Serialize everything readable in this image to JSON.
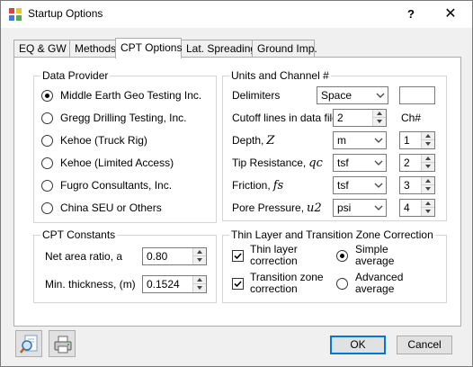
{
  "window": {
    "title": "Startup Options",
    "help": "?",
    "close": "✕"
  },
  "tabs": [
    "EQ & GW",
    "Methods",
    "CPT Options",
    "Lat. Spreading",
    "Ground Imp."
  ],
  "data_provider": {
    "title": "Data Provider",
    "options": [
      "Middle Earth Geo Testing Inc.",
      "Gregg Drilling  Testing, Inc.",
      "Kehoe (Truck Rig)",
      "Kehoe (Limited Access)",
      "Fugro Consultants, Inc.",
      "China SEU or Others"
    ],
    "selected_index": 0
  },
  "units": {
    "title": "Units and Channel #",
    "delimiters_label": "Delimiters",
    "delimiters_value": "Space",
    "cutoff_label": "Cutoff lines in data file",
    "cutoff_value": "2",
    "ch_header": "Ch#",
    "rows": [
      {
        "label": "Depth,",
        "symbol": "Z",
        "unit": "m",
        "ch": "1"
      },
      {
        "label": "Tip Resistance,",
        "symbol": "qc",
        "unit": "tsf",
        "ch": "2"
      },
      {
        "label": "Friction,",
        "symbol": "fs",
        "unit": "tsf",
        "ch": "3"
      },
      {
        "label": "Pore Pressure,",
        "symbol": "u2",
        "unit": "psi",
        "ch": "4"
      }
    ]
  },
  "cpt_constants": {
    "title": "CPT Constants",
    "net_area_label": "Net area ratio, a",
    "net_area_value": "0.80",
    "min_thickness_label": "Min. thickness, (m)",
    "min_thickness_value": "0.1524"
  },
  "thin_layer": {
    "title": "Thin Layer and Transition Zone Correction",
    "thin_layer_label_1": "Thin layer",
    "thin_layer_label_2": "correction",
    "transition_label_1": "Transition zone",
    "transition_label_2": "correction",
    "simple_label_1": "Simple",
    "simple_label_2": "average",
    "advanced_label_1": "Advanced",
    "advanced_label_2": "average"
  },
  "buttons": {
    "ok": "OK",
    "cancel": "Cancel"
  },
  "icons": {
    "preview": "magnifier-page-icon",
    "print": "printer-icon"
  },
  "colors": {
    "accent": "#0078d7"
  }
}
